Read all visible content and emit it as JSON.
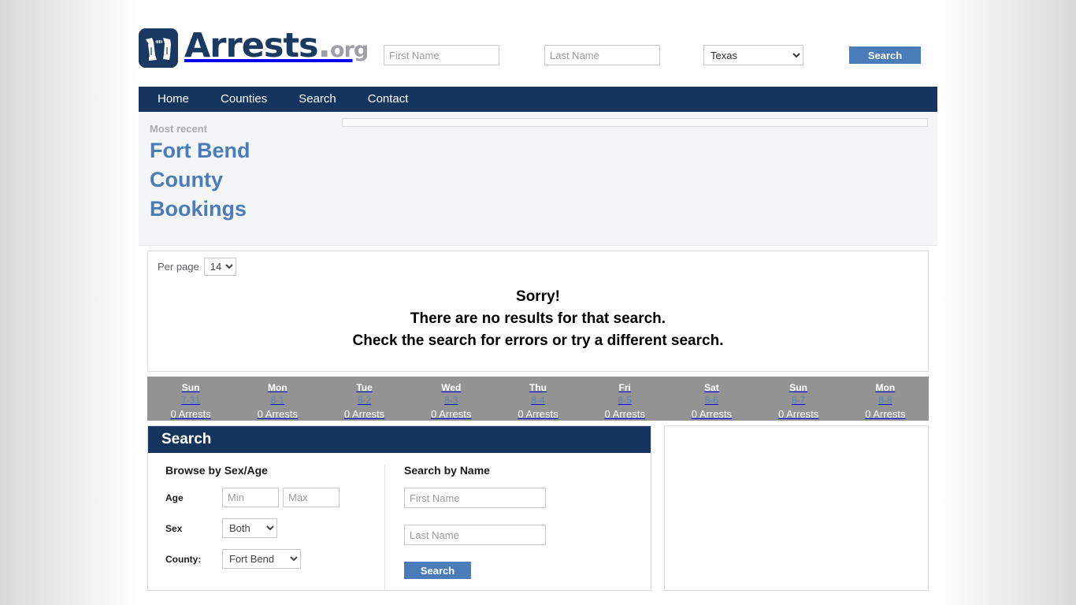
{
  "brand": {
    "logo_icon": "handcuffs-icon",
    "name": "Arrests",
    "dot": ".",
    "tld": "org"
  },
  "header": {
    "first_name_placeholder": "First Name",
    "first_name_value": "",
    "last_name_placeholder": "Last Name",
    "last_name_value": "",
    "state_selected": "Texas",
    "search_label": "Search"
  },
  "nav": {
    "items": [
      {
        "label": "Home"
      },
      {
        "label": "Counties"
      },
      {
        "label": "Search"
      },
      {
        "label": "Contact"
      }
    ]
  },
  "hero": {
    "eyebrow": "Most recent",
    "title": "Fort Bend County Bookings"
  },
  "results": {
    "per_page_label": "Per page",
    "per_page_value": "14",
    "message_line1": "Sorry!",
    "message_line2": "There are no results for that search.",
    "message_line3": "Check the search for errors or try a different search."
  },
  "date_bar": {
    "days": [
      {
        "dow": "Sun",
        "date": "7-31",
        "count": "0 Arrests"
      },
      {
        "dow": "Mon",
        "date": "8-1",
        "count": "0 Arrests"
      },
      {
        "dow": "Tue",
        "date": "8-2",
        "count": "0 Arrests"
      },
      {
        "dow": "Wed",
        "date": "8-3",
        "count": "0 Arrests"
      },
      {
        "dow": "Thu",
        "date": "8-4",
        "count": "0 Arrests"
      },
      {
        "dow": "Fri",
        "date": "8-5",
        "count": "0 Arrests"
      },
      {
        "dow": "Sat",
        "date": "8-6",
        "count": "0 Arrests"
      },
      {
        "dow": "Sun",
        "date": "8-7",
        "count": "0 Arrests"
      },
      {
        "dow": "Mon",
        "date": "8-8",
        "count": "0 Arrests"
      }
    ]
  },
  "search_panel": {
    "heading": "Search",
    "browse_title": "Browse by Sex/Age",
    "age_label": "Age",
    "age_min_placeholder": "Min",
    "age_min_value": "",
    "age_max_placeholder": "Max",
    "age_max_value": "",
    "sex_label": "Sex",
    "sex_value": "Both",
    "county_label": "County:",
    "county_value": "Fort Bend",
    "name_title": "Search by Name",
    "first_name_placeholder": "First Name",
    "first_name_value": "",
    "last_name_placeholder": "Last Name",
    "last_name_value": "",
    "search_label": "Search"
  },
  "colors": {
    "navy": "#15355e",
    "accent_blue": "#4a7cba",
    "gray_bar": "#939393",
    "hero_bg": "#f4f5f7"
  }
}
